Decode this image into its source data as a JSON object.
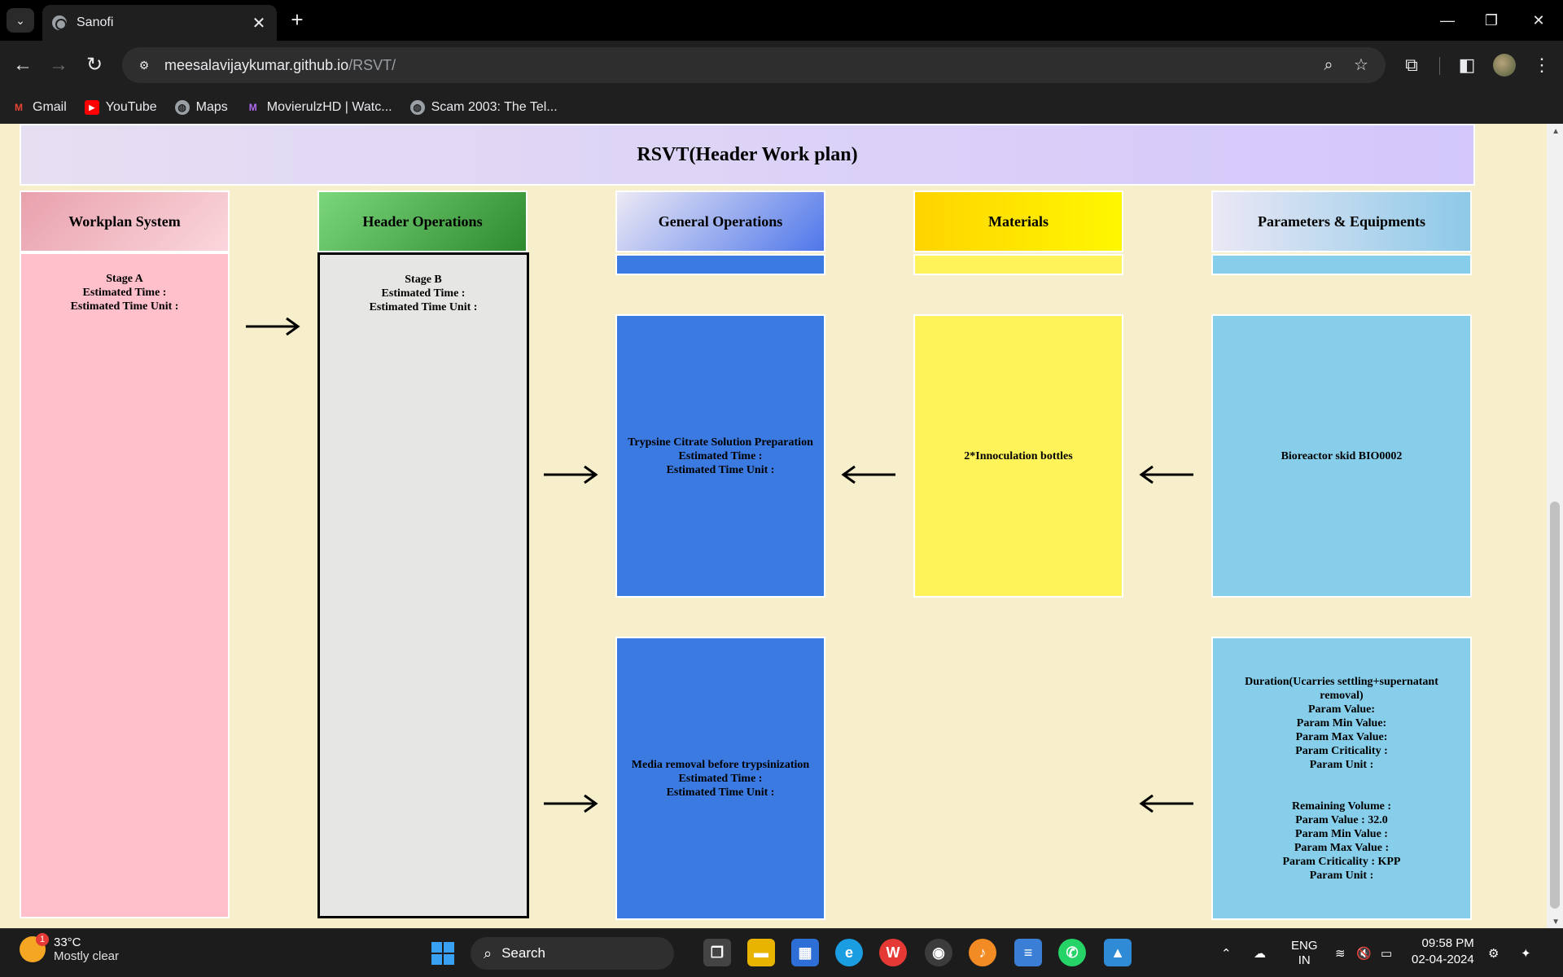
{
  "browser": {
    "tab_title": "Sanofi",
    "url_host": "meesalavijaykumar.github.io",
    "url_path": "/RSVT/",
    "bookmarks": [
      "Gmail",
      "YouTube",
      "Maps",
      "MovierulzHD | Watc...",
      "Scam 2003: The Tel..."
    ]
  },
  "page": {
    "title": "RSVT(Header Work plan)",
    "columns": {
      "workplan": "Workplan System",
      "header_ops": "Header Operations",
      "general_ops": "General Operations",
      "materials": "Materials",
      "params": "Parameters & Equipments"
    },
    "stage_a": [
      "Stage A",
      "Estimated Time :",
      "Estimated Time Unit :"
    ],
    "stage_b": [
      "Stage B",
      "Estimated Time :",
      "Estimated Time Unit :"
    ],
    "op1": [
      "Trypsine Citrate Solution Preparation",
      "Estimated Time :",
      "Estimated Time Unit :"
    ],
    "op2": [
      "Media removal before trypsinization",
      "Estimated Time :",
      "Estimated Time Unit :"
    ],
    "material1": "2*Innoculation bottles",
    "equipment1": "Bioreactor skid BIO0002",
    "param_block1": [
      "Duration(Ucarries settling+supernatant removal)",
      "Param Value:",
      "Param Min Value:",
      "Param Max Value:",
      "Param Criticality :",
      "Param Unit :"
    ],
    "param_block2": [
      "Remaining Volume :",
      "Param Value : 32.0",
      "Param Min Value :",
      "Param Max Value :",
      "Param Criticality : KPP",
      "Param Unit :"
    ]
  },
  "colors": {
    "page_bg": "#f7efcc",
    "general_ops": "#3b7ae0",
    "materials": "#fff35a",
    "params": "#87ceeb",
    "workplan": "#ffc0cb",
    "header_ops": "#e6e6e4"
  },
  "taskbar": {
    "temperature": "33°C",
    "condition": "Mostly clear",
    "weather_badge": "1",
    "search_label": "Search",
    "lang_top": "ENG",
    "lang_bottom": "IN",
    "time": "09:58 PM",
    "date": "02-04-2024"
  }
}
